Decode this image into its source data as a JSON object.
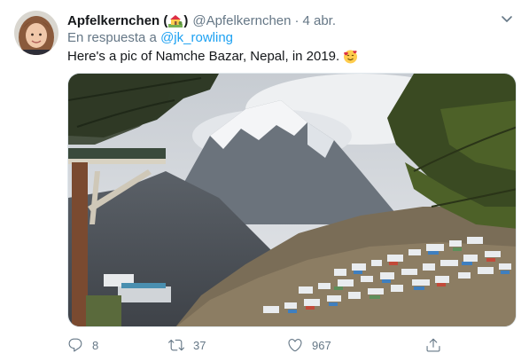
{
  "author": {
    "display_name": "Apfelkernchen (",
    "display_name_close": ")",
    "name_emoji": "house-with-garden-emoji",
    "handle": "@Apfelkernchen",
    "separator": "·",
    "date": "4 abr."
  },
  "reply": {
    "prefix": "En respuesta a",
    "mention": "@jk_rowling"
  },
  "tweet": {
    "text": "Here's a pic of Namche Bazar, Nepal, in 2019.",
    "emoji": "smiling-face-with-hearts-emoji"
  },
  "media": {
    "subject": "photo of Namche Bazar, Nepal",
    "icon": "photo"
  },
  "actions": {
    "reply_count": "8",
    "retweet_count": "37",
    "like_count": "967"
  },
  "icons": {
    "caret": "chevron-down-icon",
    "reply": "comment-icon",
    "retweet": "retweet-icon",
    "like": "heart-icon",
    "share": "share-icon"
  },
  "colors": {
    "text": "#14171a",
    "secondary": "#657786",
    "link": "#1da1f2",
    "border": "#e1e8ed"
  }
}
